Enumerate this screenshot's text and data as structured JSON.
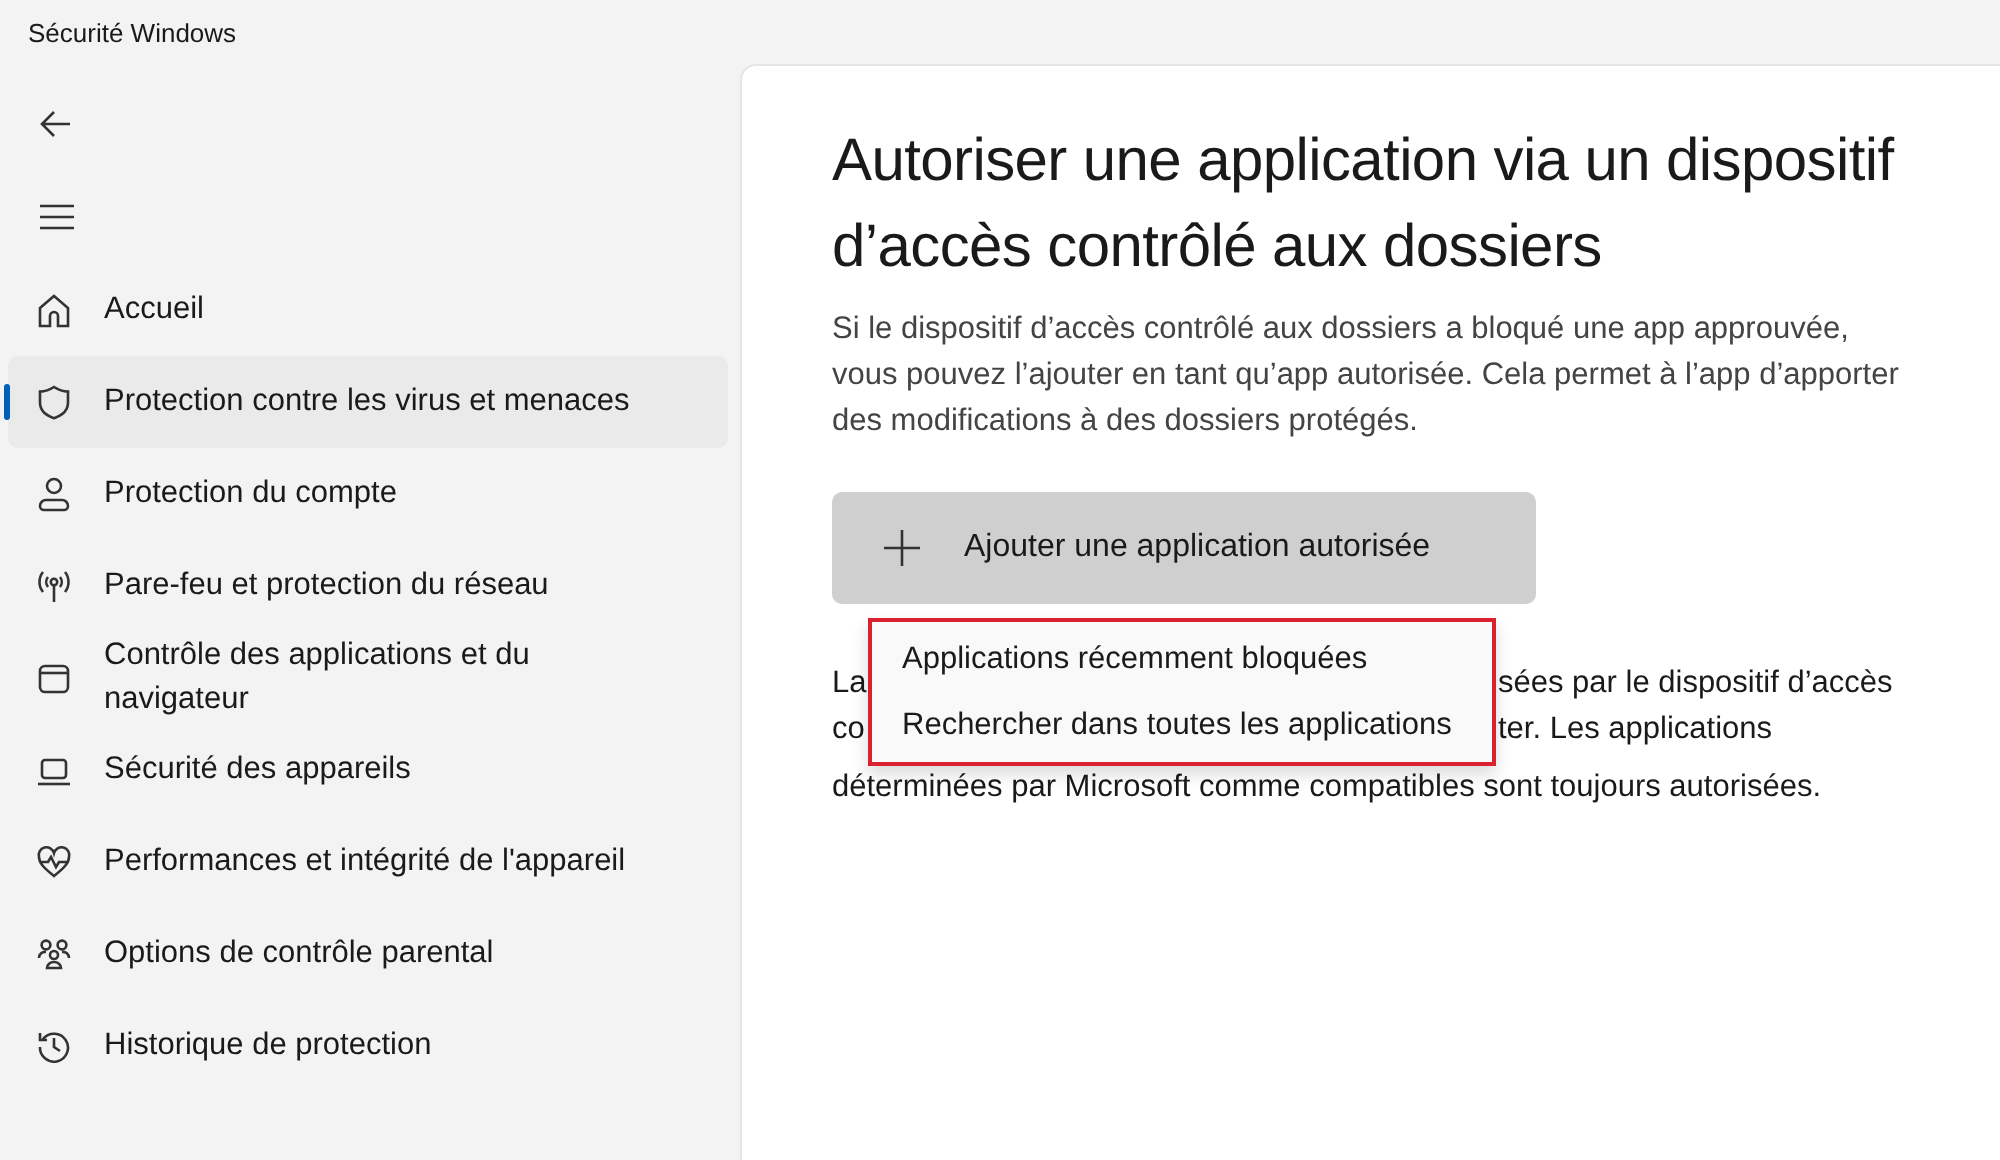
{
  "window": {
    "title": "Sécurité Windows"
  },
  "sidebar": {
    "items": [
      {
        "label": "Accueil",
        "selected": false
      },
      {
        "label": "Protection contre les virus et menaces",
        "selected": true
      },
      {
        "label": "Protection du compte",
        "selected": false
      },
      {
        "label": "Pare-feu et protection du réseau",
        "selected": false
      },
      {
        "label": "Contrôle des applications et du navigateur",
        "selected": false
      },
      {
        "label": "Sécurité des appareils",
        "selected": false
      },
      {
        "label": "Performances et intégrité de l'appareil",
        "selected": false
      },
      {
        "label": "Options de contrôle parental",
        "selected": false
      },
      {
        "label": "Historique de protection",
        "selected": false
      }
    ]
  },
  "main": {
    "title": "Autoriser une application via un dispositif d’accès contrôlé aux dossiers",
    "description": "Si le dispositif d’accès contrôlé aux dossiers a bloqué une app approuvée, vous pouvez l’ajouter en tant qu’app autorisée. Cela permet à l’app d’apporter des modifications à des dossiers protégés.",
    "add_button": {
      "label": "Ajouter une application autorisée",
      "expanded": true
    },
    "menu": {
      "items": [
        {
          "label": "Applications récemment bloquées"
        },
        {
          "label": "Rechercher dans toutes les applications"
        }
      ]
    },
    "partial_text_lines": [
      {
        "left": "La",
        "right": "sées par le dispositif d’accès"
      },
      {
        "left": "co",
        "right": "ter. Les applications"
      },
      {
        "left": "déterminées par Microsoft comme compatibles sont toujours autorisées."
      }
    ]
  }
}
